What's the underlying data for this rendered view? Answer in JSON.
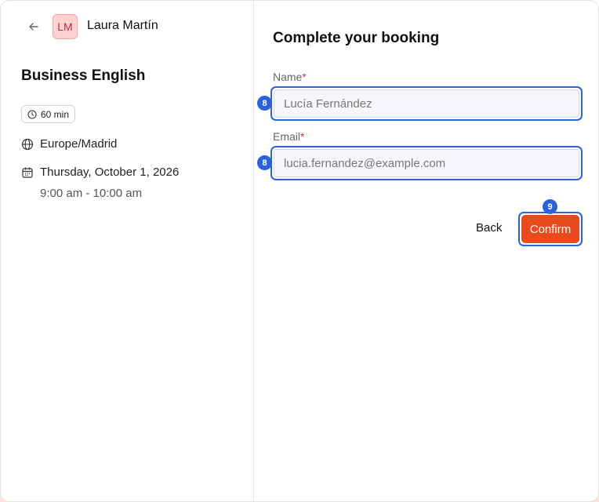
{
  "host": {
    "initials": "LM",
    "name": "Laura Martín",
    "avatar_bg": "#ffd1d1"
  },
  "event": {
    "title": "Business English",
    "duration": "60 min",
    "timezone": "Europe/Madrid",
    "date": "Thursday, October 1, 2026",
    "time": "9:00 am - 10:00 am"
  },
  "form": {
    "title": "Complete your booking",
    "name_label": "Name",
    "email_label": "Email",
    "required_mark": "*",
    "name_value": "Lucía Fernández",
    "email_value": "lucia.fernandez@example.com",
    "back_label": "Back",
    "confirm_label": "Confirm"
  },
  "badges": {
    "name": "8",
    "email": "8",
    "confirm": "9"
  },
  "colors": {
    "accent": "#e8491d",
    "highlight": "#2b62d9"
  },
  "icons": {
    "back": "arrow-left-icon",
    "duration": "clock-icon",
    "timezone": "globe-icon",
    "date": "calendar-icon"
  }
}
